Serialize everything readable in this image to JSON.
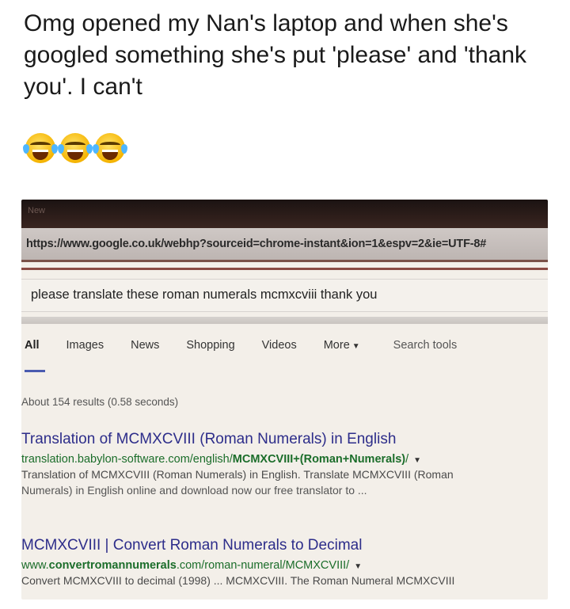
{
  "caption": "Omg opened my Nan's laptop and when she's googled something she's put 'please' and 'thank you'. I can't",
  "emoji_count": 3,
  "photo": {
    "tab_ghost": "New",
    "url": "https://www.google.co.uk/webhp?sourceid=chrome-instant&ion=1&espv=2&ie=UTF-8#",
    "query": "please translate these roman numerals mcmxcviii thank you",
    "tabs": [
      {
        "label": "All"
      },
      {
        "label": "Images"
      },
      {
        "label": "News"
      },
      {
        "label": "Shopping"
      },
      {
        "label": "Videos"
      },
      {
        "label": "More"
      }
    ],
    "search_tools": "Search tools",
    "result_count": "About 154 results (0.58 seconds)",
    "results": [
      {
        "title": "Translation of MCMXCVIII (Roman Numerals) in English",
        "url_prefix": "translation.babylon-software.com/english/",
        "url_bold": "MCMXCVIII+(Roman+Numerals)",
        "url_suffix": "/",
        "snippet1": "Translation of MCMXCVIII (Roman Numerals) in English. Translate MCMXCVIII (Roman",
        "snippet2": "Numerals) in English online and download now our free translator to ..."
      },
      {
        "title": "MCMXCVIII | Convert Roman Numerals to Decimal",
        "url_prefix": "www.",
        "url_bold": "convertromannumerals",
        "url_suffix": ".com/roman-numeral/MCMXCVIII/",
        "snippet1": "Convert MCMXCVIII to decimal (1998) ... MCMXCVIII. The Roman Numeral MCMXCVIII",
        "snippet2": ""
      }
    ]
  }
}
